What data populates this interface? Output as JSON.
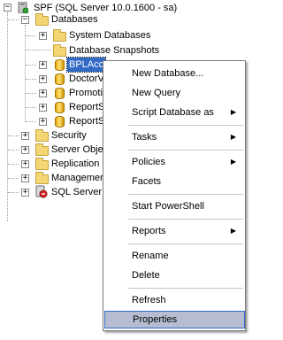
{
  "tree": {
    "server": "SPF (SQL Server 10.0.1600 - sa)",
    "databases": "Databases",
    "system_databases": "System Databases",
    "database_snapshots": "Database Snapshots",
    "db1": "BPLAcc",
    "db2": "DoctorV",
    "db3": "Promoti",
    "db4": "ReportS",
    "db5": "ReportS",
    "security": "Security",
    "server_objects": "Server Obje",
    "replication": "Replication",
    "management": "Managemer",
    "agent": "SQL Server",
    "expand_minus": "−",
    "expand_plus": "+"
  },
  "menu": {
    "new_database": "New Database...",
    "new_query": "New Query",
    "script_database_as": "Script Database as",
    "tasks": "Tasks",
    "policies": "Policies",
    "facets": "Facets",
    "start_powershell": "Start PowerShell",
    "reports": "Reports",
    "rename": "Rename",
    "delete": "Delete",
    "refresh": "Refresh",
    "properties": "Properties",
    "submenu_arrow": "▶"
  },
  "colors": {
    "selection": "#316ac5",
    "menu_highlight": "#b6bdd2",
    "folder": "#f4d775"
  }
}
